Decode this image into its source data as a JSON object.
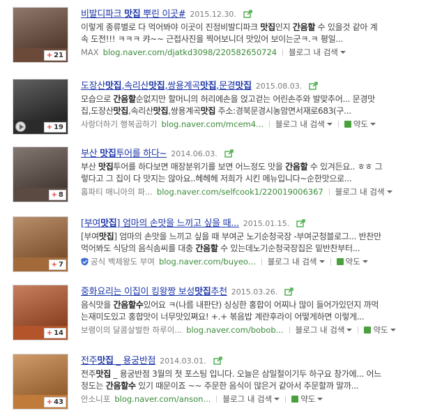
{
  "results": [
    {
      "title_parts": [
        {
          "text": "비발디파크 ",
          "bold": false
        },
        {
          "text": "맛집",
          "bold": true
        },
        {
          "text": " 뿌린 이곳#",
          "bold": false
        }
      ],
      "date": "2015.12.30.",
      "desc_line1": "이렇게 종류별로 다 먹어봐야 이곳이 진정비발디파크 맛집인지 간음할 수 있을것 같아 계",
      "desc_line2": "속 도전!!! ㅋㅋㅋ 캬~~ 근접사진을 찍어보니더 맛있어 보이는군ㅋ.ㅋ 평일...",
      "source": "MAX",
      "url": "blog.naver.com/djatkd3098/220582650724",
      "blog_search": "블로그 내 검색",
      "map": "",
      "count": "21",
      "has_video": false,
      "thumb_color": "#6b4a3a"
    },
    {
      "title_parts": [
        {
          "text": "도장산",
          "bold": false
        },
        {
          "text": "맛집",
          "bold": true
        },
        {
          "text": ",속리산",
          "bold": false
        },
        {
          "text": "맛집",
          "bold": true
        },
        {
          "text": ",쌍용계곡",
          "bold": false
        },
        {
          "text": "맛집",
          "bold": true
        },
        {
          "text": ",문경",
          "bold": false
        },
        {
          "text": "맛집",
          "bold": true
        }
      ],
      "date": "2015.08.03.",
      "desc_line1": "모습으로 간음할순없지만 할머니의 허리에손을 얹고걷는 어린손주와 발맞추어... 문경맛",
      "desc_line2": "집,도장산맛집,속리산맛집,쌍용계곡맛집 주소:경북문경시농암면서재로683(구...",
      "source": "사랑더하기 행복곱하기",
      "url": "blog.naver.com/mcem4...",
      "blog_search": "블로그 내 검색",
      "map": "약도",
      "count": "19",
      "has_video": true,
      "thumb_color": "#2b2b2b"
    },
    {
      "title_parts": [
        {
          "text": "부산 ",
          "bold": false
        },
        {
          "text": "맛집",
          "bold": true
        },
        {
          "text": "투어를 하다~",
          "bold": false
        }
      ],
      "date": "2014.06.03.",
      "desc_line1": "부산 맛집투어를 하다보면 매장분위기를 보면 어느정도 맛을 간음할 수 있겨든요.. ㅎㅎ 그",
      "desc_line2": "렇다고 그 집이 다 맛지는 않아요..헤헤헤 저희가 시킨 메뉴입니다~순한맛으로...",
      "source": "홈파티 매니아의 파...",
      "url": "blog.naver.com/selfcook1/220019006367",
      "blog_search": "블로그 내 검색",
      "map": "",
      "count": "8",
      "has_video": false,
      "thumb_color": "#5a4a42"
    },
    {
      "title_parts": [
        {
          "text": "[부여",
          "bold": false
        },
        {
          "text": "맛집",
          "bold": true
        },
        {
          "text": "] 엄마의 손맛을 느끼고 싶을 때...",
          "bold": false
        }
      ],
      "date": "2015.01.15.",
      "desc_line1": "[부여맛집] 엄마의 손맛을 느끼고 싶을 때 부여군 노기순청국장 -부여군청블로그... 반찬만",
      "desc_line2": "먹어봐도 식당의 음식솜씨를 대충 간음할 수 있는데노기순청국장집은 밑반찬부터...",
      "source": "공식 백제왕도 부여",
      "url": "blog.naver.com/buyeo...",
      "blog_search": "블로그 내 검색",
      "map": "약도",
      "count": "7",
      "has_video": false,
      "thumb_color": "#a26a3a"
    },
    {
      "title_parts": [
        {
          "text": "중화요리는 이집이 킹왕짱 보성",
          "bold": false
        },
        {
          "text": "맛집",
          "bold": true
        },
        {
          "text": "추천",
          "bold": false
        }
      ],
      "date": "2015.03.26.",
      "desc_line1": "음식맛을 간음할수있어요 ㅋ(나름 내판단) 싱싱한 홍합이 어찌나 많이 들어가있던지 까먹",
      "desc_line2": "는재미도있고 홍합맛이 너무맛있쪄요! +.+ 볶음밥 계란후라이 어떻게하면 이렇게...",
      "source": "보랭이의 달콤살벌한 하루이...",
      "url": "blog.naver.com/bobob...",
      "blog_search": "블로그 내 검색",
      "map": "약도",
      "count": "14",
      "has_video": false,
      "thumb_color": "#b4542a"
    },
    {
      "title_parts": [
        {
          "text": "전주",
          "bold": false
        },
        {
          "text": "맛집",
          "bold": true
        },
        {
          "text": " _ 용궁반점",
          "bold": false
        }
      ],
      "date": "2014.03.01.",
      "desc_line1": "전주맛집 _ 용궁반점 3월의 첫 포스팅 입니다. 오늘은 삼일절이기두 하구요 창가에... 어느",
      "desc_line2": "정도는 간음할수 있기 때문이죠 ~~ 주문한 음식이 많은거 같아서 주문할까 말까...",
      "source": "안소니포",
      "url": "blog.naver.com/anson...",
      "blog_search": "블로그 내 검색",
      "map": "약도",
      "count": "43",
      "has_video": false,
      "thumb_color": "#c07a3a"
    }
  ]
}
